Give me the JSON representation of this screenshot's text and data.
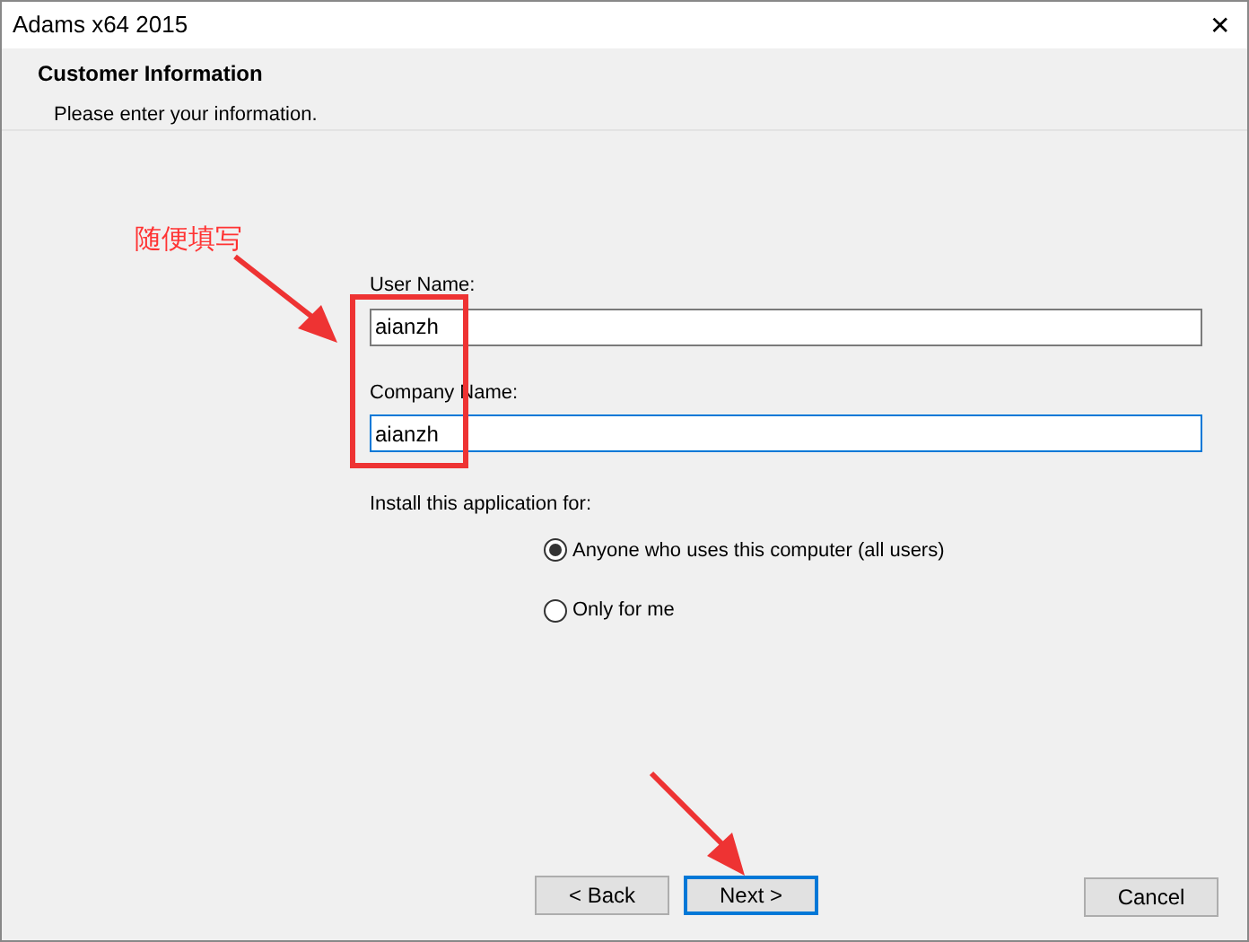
{
  "window": {
    "title": "Adams x64 2015",
    "close": "✕"
  },
  "header": {
    "title": "Customer Information",
    "subtitle": "Please enter your information."
  },
  "fields": [
    {
      "label": "User Name:",
      "value": "aianzh",
      "focused": false
    },
    {
      "label": "Company Name:",
      "value": "aianzh",
      "focused": true
    }
  ],
  "install_for": {
    "label": "Install this application for:",
    "options": [
      {
        "label": "Anyone who uses this computer (all users)",
        "selected": true
      },
      {
        "label": "Only for me",
        "selected": false
      }
    ]
  },
  "buttons": [
    {
      "label": "< Back",
      "default": false
    },
    {
      "label": "Next >",
      "default": true
    },
    {
      "label": "Cancel",
      "default": false
    }
  ],
  "annotation": {
    "note": "随便填写"
  }
}
